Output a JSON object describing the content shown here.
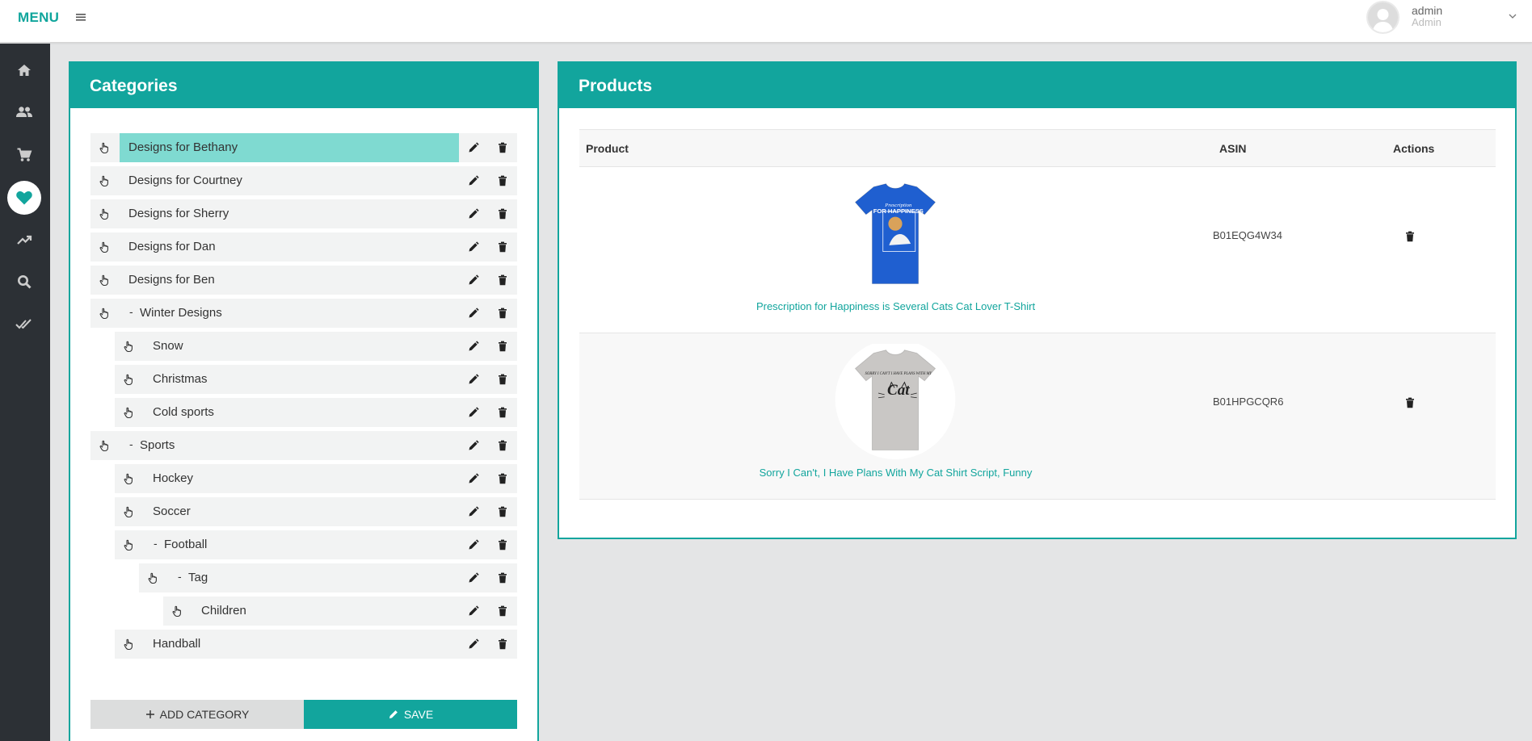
{
  "header": {
    "menu_label": "MENU",
    "user": {
      "name": "admin",
      "role": "Admin"
    }
  },
  "sidebar": {
    "items": [
      {
        "icon": "home-icon",
        "active": false
      },
      {
        "icon": "users-icon",
        "active": false
      },
      {
        "icon": "cart-icon",
        "active": false
      },
      {
        "icon": "heart-icon",
        "active": true
      },
      {
        "icon": "trending-icon",
        "active": false
      },
      {
        "icon": "search-icon",
        "active": false
      },
      {
        "icon": "double-check-icon",
        "active": false
      }
    ]
  },
  "categories": {
    "title": "Categories",
    "items": [
      {
        "label": "Designs for Bethany",
        "level": 0,
        "selected": true,
        "collapsible": false
      },
      {
        "label": "Designs for Courtney",
        "level": 0,
        "collapsible": false
      },
      {
        "label": "Designs for Sherry",
        "level": 0,
        "collapsible": false
      },
      {
        "label": "Designs for Dan",
        "level": 0,
        "collapsible": false
      },
      {
        "label": "Designs for Ben",
        "level": 0,
        "collapsible": false
      },
      {
        "label": "Winter Designs",
        "level": 0,
        "collapsible": true,
        "toggle": "-"
      },
      {
        "label": "Snow",
        "level": 1,
        "collapsible": false
      },
      {
        "label": "Christmas",
        "level": 1,
        "collapsible": false
      },
      {
        "label": "Cold sports",
        "level": 1,
        "collapsible": false
      },
      {
        "label": "Sports",
        "level": 0,
        "collapsible": true,
        "toggle": "-"
      },
      {
        "label": "Hockey",
        "level": 1,
        "collapsible": false
      },
      {
        "label": "Soccer",
        "level": 1,
        "collapsible": false
      },
      {
        "label": "Football",
        "level": 1,
        "collapsible": true,
        "toggle": "-"
      },
      {
        "label": "Tag",
        "level": 2,
        "collapsible": true,
        "toggle": "-"
      },
      {
        "label": "Children",
        "level": 3,
        "collapsible": false
      },
      {
        "label": "Handball",
        "level": 1,
        "collapsible": false
      }
    ],
    "add_label": "ADD CATEGORY",
    "save_label": "SAVE"
  },
  "products": {
    "title": "Products",
    "columns": {
      "product": "Product",
      "asin": "ASIN",
      "actions": "Actions"
    },
    "rows": [
      {
        "name": "Prescription for Happiness is Several Cats Cat Lover T-Shirt",
        "asin": "B01EQG4W34",
        "shirt_color": "#1f5fd0",
        "print_top": "Prescription",
        "print_main": "FOR HAPPINESS"
      },
      {
        "name": "Sorry I Can't, I Have Plans With My Cat Shirt Script, Funny",
        "asin": "B01HPGCQR6",
        "shirt_color": "#c9c7c5",
        "print_top": "SORRY I CAN'T I HAVE PLANS WITH MY",
        "print_main": "Cat"
      }
    ]
  },
  "colors": {
    "accent": "#12a59d",
    "sidebar": "#2c3035",
    "selected": "#7fdad1"
  }
}
